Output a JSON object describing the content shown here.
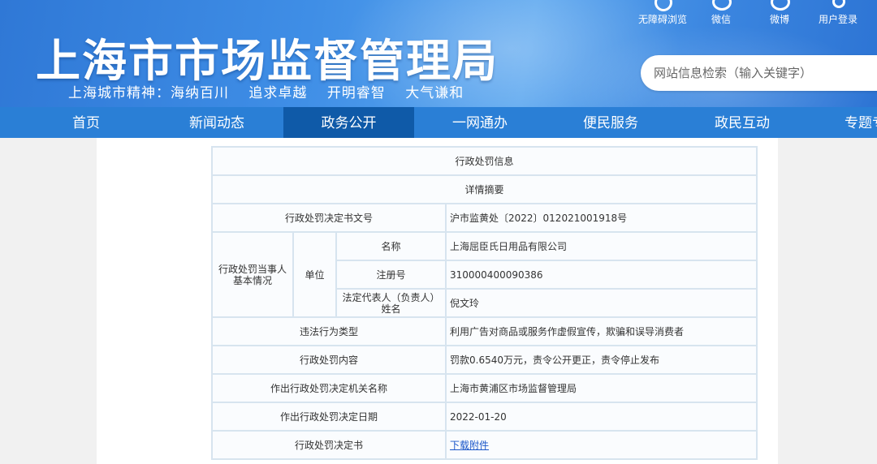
{
  "header": {
    "site_title": "上海市市场监督管理局",
    "slogan": [
      "上海城市精神：海纳百川",
      "追求卓越",
      "开明睿智",
      "大气谦和"
    ],
    "top_links": [
      {
        "label": "无障碍浏览",
        "icon": "accessibility-icon"
      },
      {
        "label": "微信",
        "icon": "wechat-icon"
      },
      {
        "label": "微博",
        "icon": "weibo-icon"
      },
      {
        "label": "用户登录",
        "icon": "user-icon"
      }
    ],
    "search_placeholder": "网站信息检索（输入关键字）"
  },
  "nav": {
    "items": [
      "首页",
      "新闻动态",
      "政务公开",
      "一网通办",
      "便民服务",
      "政民互动",
      "专题专栏"
    ],
    "active": "政务公开"
  },
  "table": {
    "title": "行政处罚信息",
    "subtitle": "详情摘要",
    "decision_no_label": "行政处罚决定书文号",
    "decision_no": "沪市监黄处〔2022〕012021001918号",
    "party_label": "行政处罚当事人基本情况",
    "unit_label": "单位",
    "name_label": "名称",
    "name": "上海屈臣氏日用品有限公司",
    "reg_no_label": "注册号",
    "reg_no": "310000400090386",
    "legal_rep_label": "法定代表人（负责人）姓名",
    "legal_rep": "倪文玲",
    "violation_type_label": "违法行为类型",
    "violation_type": "利用广告对商品或服务作虚假宣传，欺骗和误导消费者",
    "penalty_content_label": "行政处罚内容",
    "penalty_content": "罚款0.6540万元，责令公开更正，责令停止发布",
    "authority_label": "作出行政处罚决定机关名称",
    "authority": "上海市黄浦区市场监督管理局",
    "date_label": "作出行政处罚决定日期",
    "date": "2022-01-20",
    "document_label": "行政处罚决定书",
    "document_link": "下载附件"
  }
}
